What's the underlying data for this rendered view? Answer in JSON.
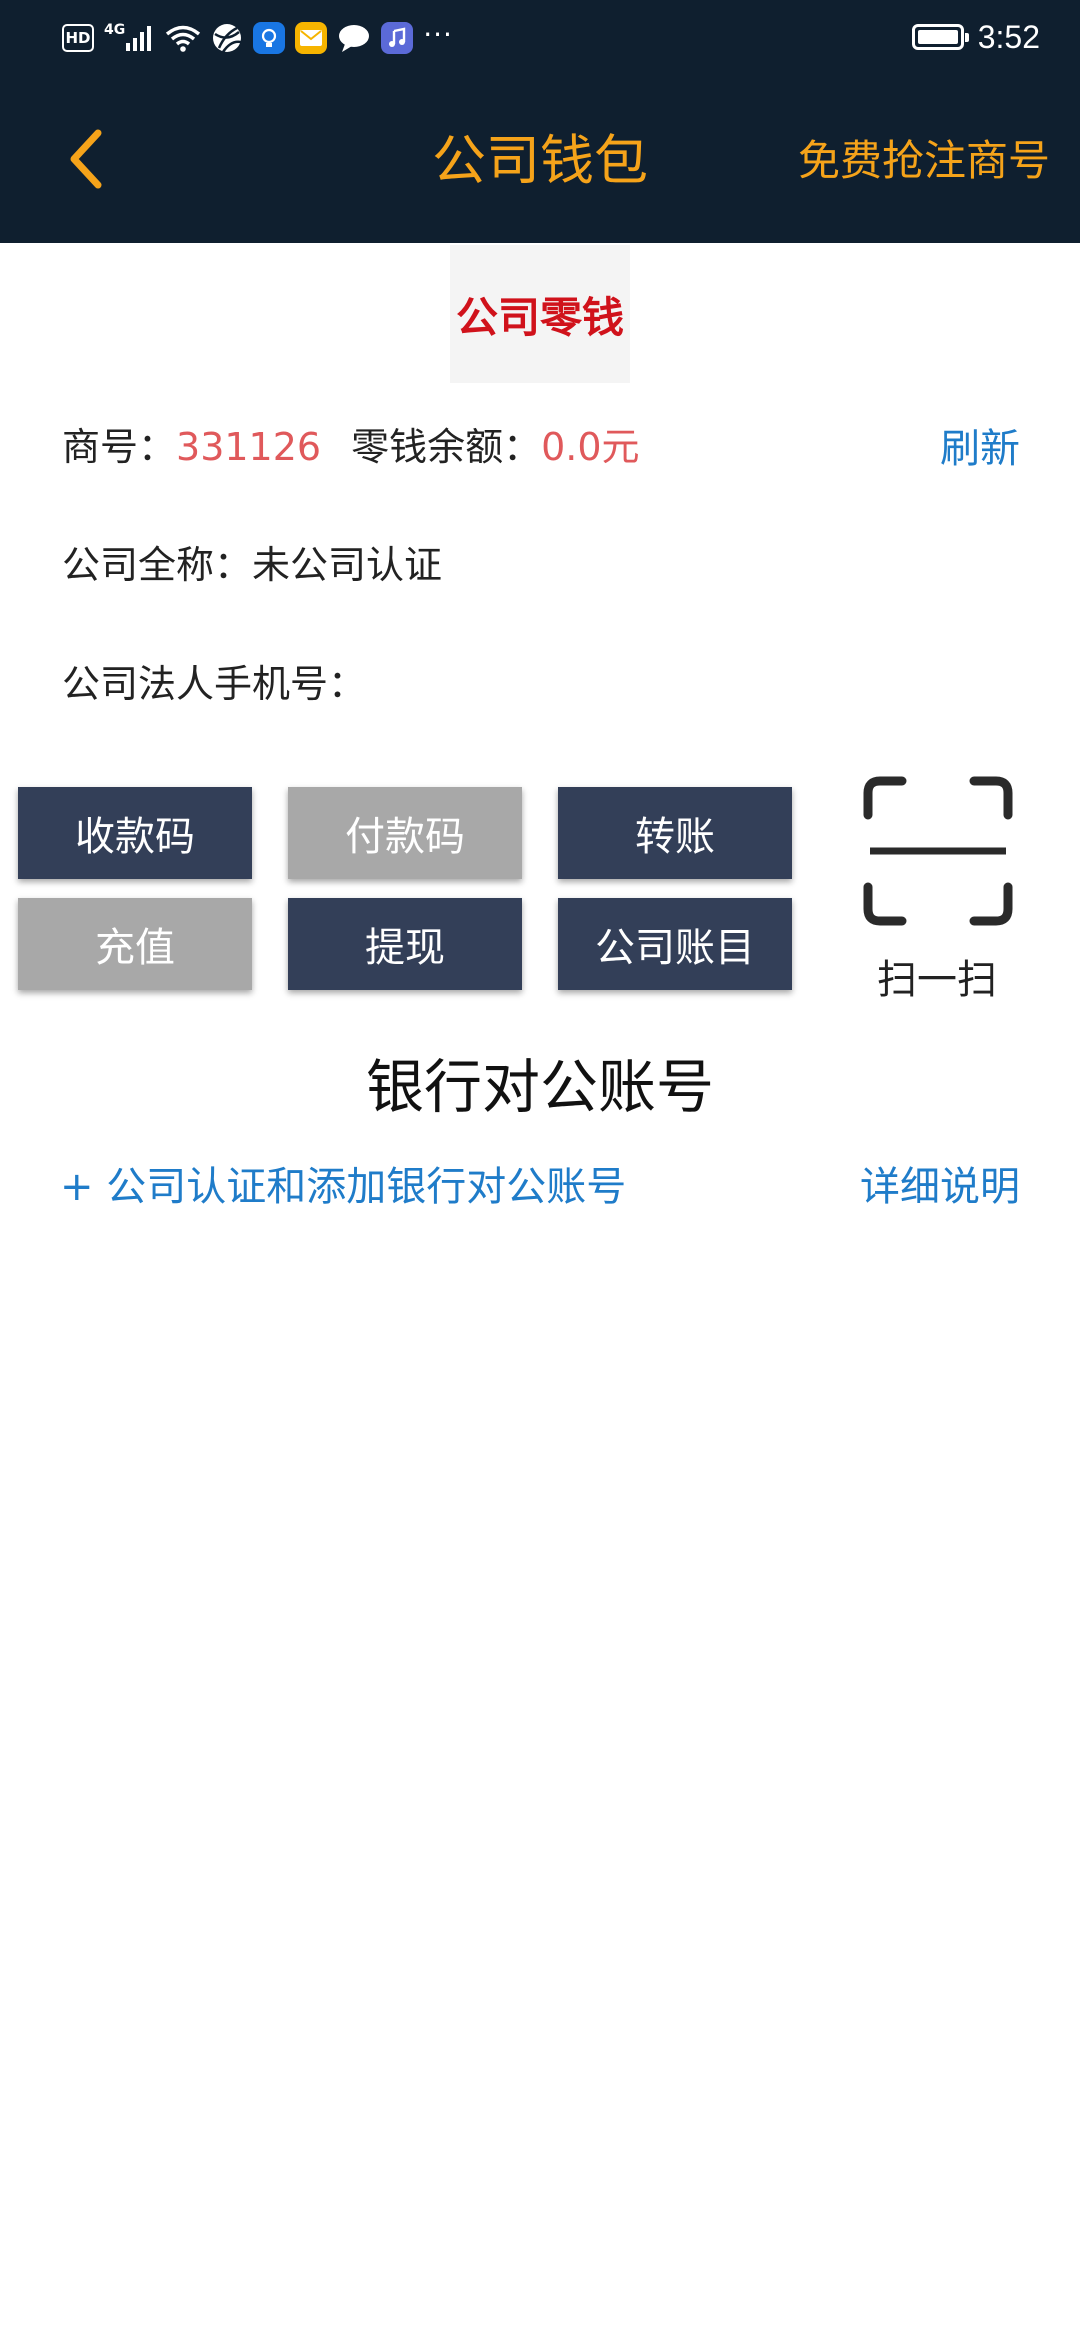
{
  "status_bar": {
    "hd": "HD",
    "network": "4G",
    "time": "3:52",
    "battery_level": 1.0,
    "icons": [
      "hd-icon",
      "signal-icon",
      "wifi-icon",
      "app-icon",
      "bulb-app-icon",
      "mail-app-icon",
      "chat-icon",
      "music-app-icon",
      "more-icon",
      "battery-icon"
    ]
  },
  "header": {
    "title": "公司钱包",
    "action": "免费抢注商号",
    "back_icon": "chevron-left-icon",
    "colors": {
      "background": "#0f1f2f",
      "accent": "#f5a31a"
    }
  },
  "tab": {
    "label": "公司零钱",
    "color": "#d0121b"
  },
  "info": {
    "shop_no_label": "商号：",
    "shop_no": "331126",
    "balance_label": "零钱余额：",
    "balance": "0.0元",
    "refresh": "刷新",
    "full_name_label": "公司全称：",
    "full_name": "未公司认证",
    "phone_label": "公司法人手机号："
  },
  "buttons": {
    "collect": "收款码",
    "pay": "付款码",
    "transfer": "转账",
    "recharge": "充值",
    "withdraw": "提现",
    "accounts": "公司账目",
    "colors": {
      "dark": "#333f58",
      "gray": "#a8a8a8"
    }
  },
  "scan": {
    "label": "扫一扫",
    "icon": "scan-icon"
  },
  "bank": {
    "title": "银行对公账号",
    "add_link": "+ 公司认证和添加银行对公账号",
    "detail_link": "详细说明",
    "link_color": "#1f7cc9"
  }
}
